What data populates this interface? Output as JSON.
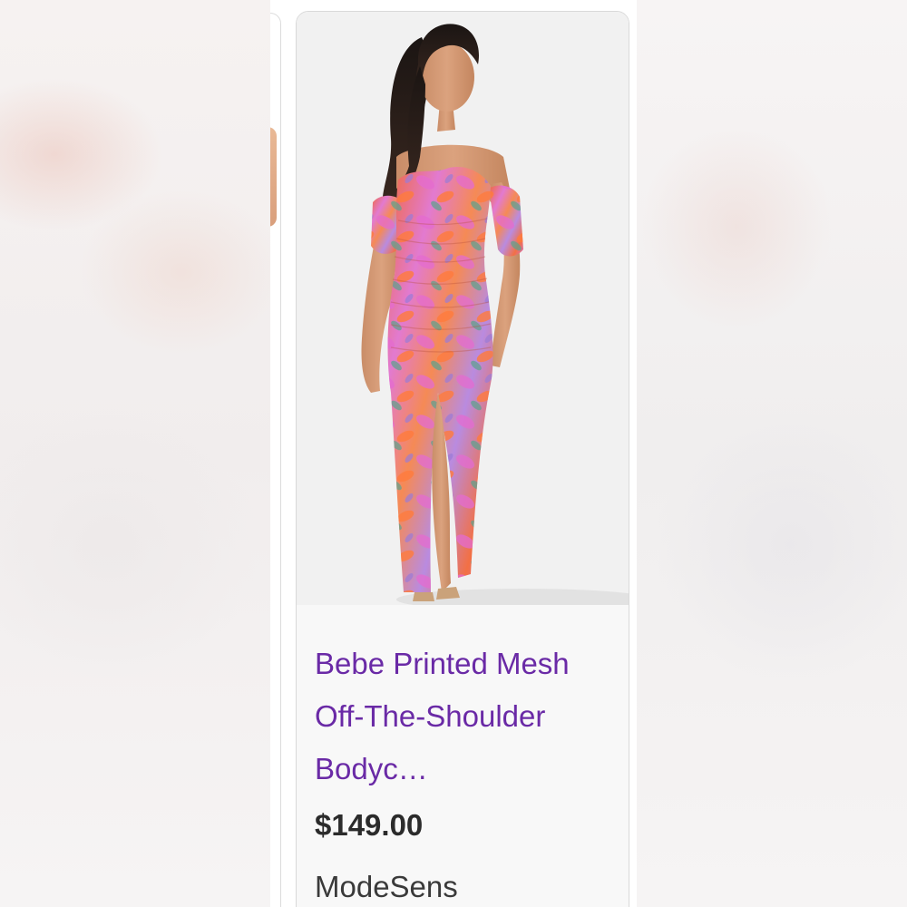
{
  "product": {
    "title": "Bebe Printed Mesh Off-The-Shoulder Bodyc…",
    "price": "$149.00",
    "seller": "ModeSens",
    "image_alt": "Model wearing a floral printed off-the-shoulder ruched bodycon maxi dress"
  },
  "colors": {
    "title_link": "#6a2aa6",
    "price": "#2b2b2b",
    "seller": "#3a3a3a",
    "card_bg": "#f8f8f8",
    "image_bg": "#f1f1f1"
  }
}
